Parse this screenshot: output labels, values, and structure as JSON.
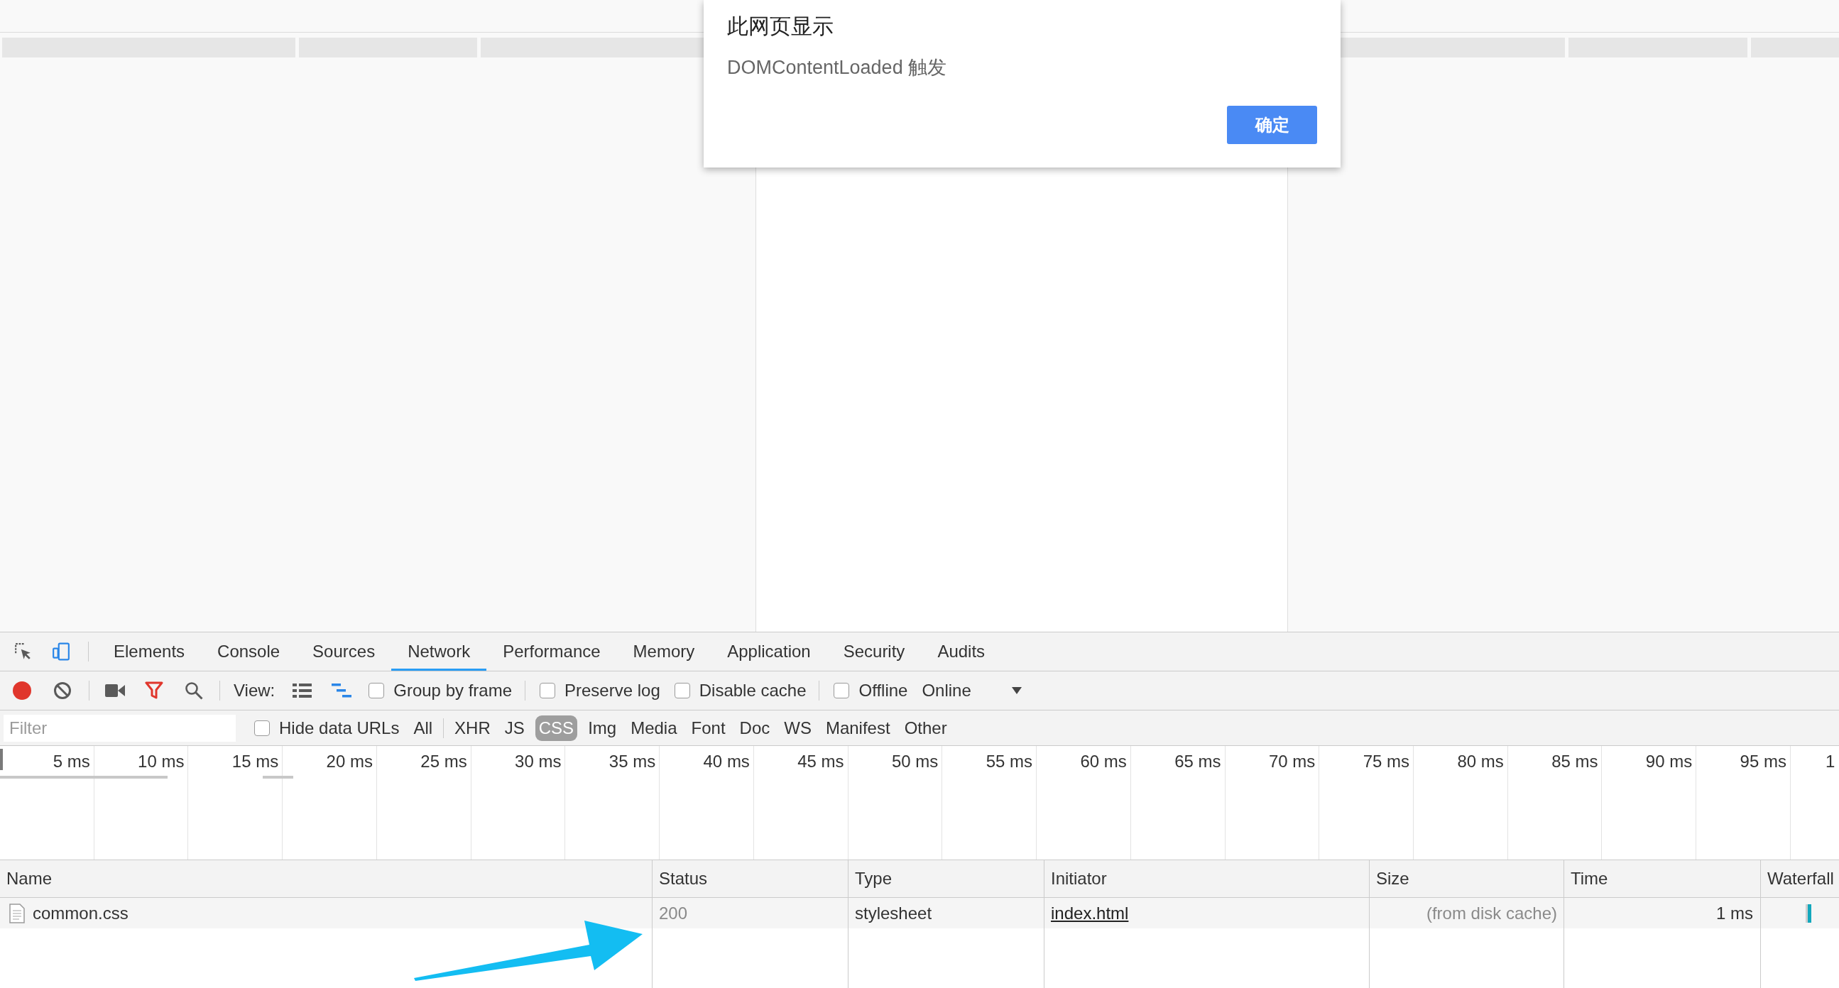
{
  "dialog": {
    "title": "此网页显示",
    "message": "DOMContentLoaded 触发",
    "button": "确定"
  },
  "devtools": {
    "inspect_active": false,
    "device_mode": true,
    "tabs": [
      {
        "label": "Elements",
        "selected": false
      },
      {
        "label": "Console",
        "selected": false
      },
      {
        "label": "Sources",
        "selected": false
      },
      {
        "label": "Network",
        "selected": true
      },
      {
        "label": "Performance",
        "selected": false
      },
      {
        "label": "Memory",
        "selected": false
      },
      {
        "label": "Application",
        "selected": false
      },
      {
        "label": "Security",
        "selected": false
      },
      {
        "label": "Audits",
        "selected": false
      }
    ],
    "toolbar": {
      "recording": true,
      "filter_shown": true,
      "view_label": "View:",
      "large_rows": false,
      "overview": true,
      "option_groups": [
        [
          {
            "label": "Group by frame",
            "checked": false
          }
        ],
        [
          {
            "label": "Preserve log",
            "checked": false
          },
          {
            "label": "Disable cache",
            "checked": false
          }
        ],
        [
          {
            "label": "Offline",
            "checked": false
          }
        ]
      ],
      "throttling": "Online"
    },
    "filter_bar": {
      "placeholder": "Filter",
      "hide_data_urls": {
        "label": "Hide data URLs",
        "checked": false
      },
      "all": {
        "label": "All",
        "selected": false
      },
      "types": [
        {
          "label": "XHR",
          "selected": false
        },
        {
          "label": "JS",
          "selected": false
        },
        {
          "label": "CSS",
          "selected": true
        },
        {
          "label": "Img",
          "selected": false
        },
        {
          "label": "Media",
          "selected": false
        },
        {
          "label": "Font",
          "selected": false
        },
        {
          "label": "Doc",
          "selected": false
        },
        {
          "label": "WS",
          "selected": false
        },
        {
          "label": "Manifest",
          "selected": false
        },
        {
          "label": "Other",
          "selected": false
        }
      ]
    },
    "overview": {
      "ticks": [
        "5 ms",
        "10 ms",
        "15 ms",
        "20 ms",
        "25 ms",
        "30 ms",
        "35 ms",
        "40 ms",
        "45 ms",
        "50 ms",
        "55 ms",
        "60 ms",
        "65 ms",
        "70 ms",
        "75 ms",
        "80 ms",
        "85 ms",
        "90 ms",
        "95 ms",
        "1"
      ]
    },
    "table": {
      "columns": [
        "Name",
        "Status",
        "Type",
        "Initiator",
        "Size",
        "Time",
        "Waterfall"
      ],
      "rows": [
        {
          "name": "common.css",
          "status": "200",
          "type": "stylesheet",
          "initiator": "index.html",
          "size": "(from disk cache)",
          "time": "1 ms"
        }
      ]
    }
  }
}
